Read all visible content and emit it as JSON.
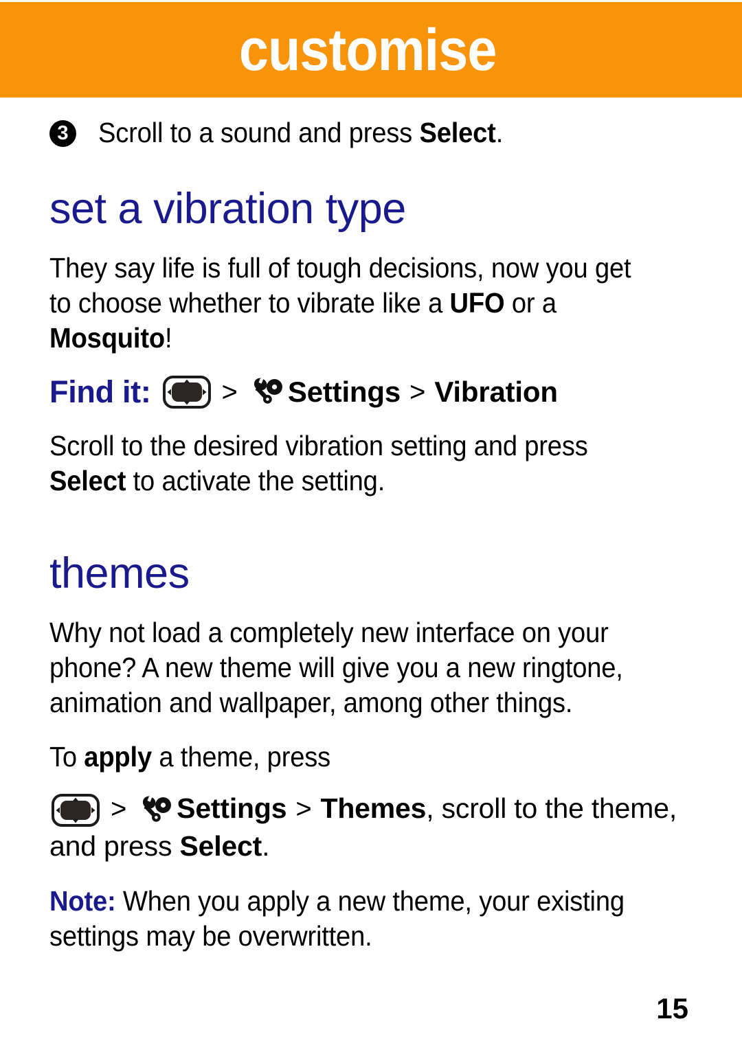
{
  "header": {
    "title": "customise",
    "background_color": "#f9930a",
    "text_color": "#ffffff"
  },
  "theme": {
    "heading_color": "#1a1a8c",
    "body_color": "#000000",
    "accent_orange": "#f9930a"
  },
  "step": {
    "number": "3",
    "text_before": "Scroll to a sound and press ",
    "text_bold": "Select",
    "text_after": "."
  },
  "sections": {
    "vibration": {
      "heading": "set a vibration type",
      "para1_a": "They say life is full of tough decisions, now you get to choose whether to vibrate like a ",
      "para1_bold1": "UFO",
      "para1_b": " or a ",
      "para1_bold2": "Mosquito",
      "para1_c": "!",
      "findit_label": "Find it:",
      "findit_icon_dpad": "dpad-key-icon",
      "findit_chevron1": ">",
      "findit_icon_settings": "settings-wrench-gear-icon",
      "findit_path": "Settings",
      "findit_chevron2": ">",
      "findit_path2": "Vibration",
      "para2_a": "Scroll to the desired vibration setting and press ",
      "para2_bold": "Select",
      "para2_b": " to activate the setting."
    },
    "themes": {
      "heading": "themes",
      "para1": "Why not load a completely new interface on your phone? A new theme will give you a new ringtone, animation and wallpaper, among other things.",
      "apply_a": "To ",
      "apply_bold": "apply",
      "apply_b": " a theme, press",
      "path_icon_dpad": "dpad-key-icon",
      "path_chevron1": ">",
      "path_icon_settings": "settings-wrench-gear-icon",
      "path_settings": "Settings",
      "path_chevron2": ">",
      "path_themes": "Themes",
      "path_tail": ", scroll to the theme, and press ",
      "path_select": "Select",
      "path_period": ".",
      "note_label": "Note:",
      "note_text": " When you apply a new theme, your existing settings may be overwritten."
    }
  },
  "footer": {
    "page_number": "15"
  }
}
